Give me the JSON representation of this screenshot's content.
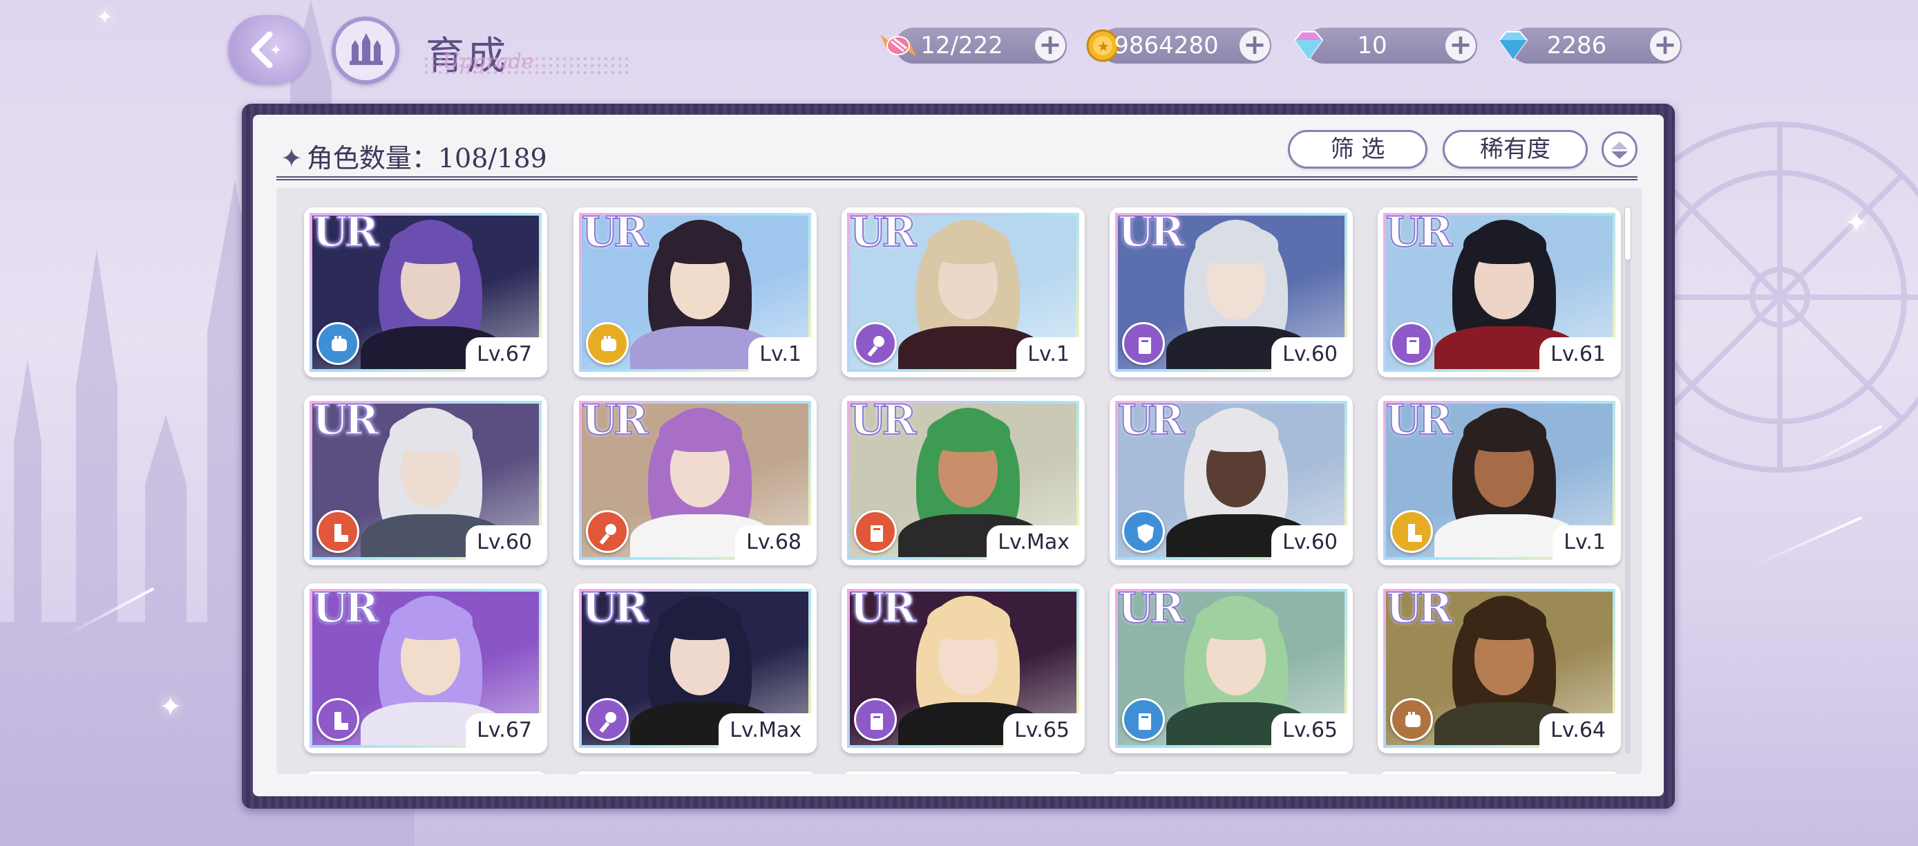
{
  "header": {
    "title": "育成",
    "subtitle_script": "Upgrade"
  },
  "resources": [
    {
      "name": "candy",
      "value": "12/222"
    },
    {
      "name": "coin",
      "value": "9864280"
    },
    {
      "name": "gem",
      "value": "10"
    },
    {
      "name": "diamond",
      "value": "2286"
    }
  ],
  "panel": {
    "count_label": "角色数量：108/189",
    "filter_label": "筛 选",
    "rarity_label": "稀有度"
  },
  "colors": {
    "vocal": "#8e5ac9",
    "blue": "#3f8fd6",
    "red": "#e0573a",
    "gold": "#e6ad22",
    "brown": "#b0733f"
  },
  "cards": [
    {
      "rarity": "UR",
      "level": "Lv.67",
      "type": "blue-fist-icon"
    },
    {
      "rarity": "UR",
      "level": "Lv.1",
      "type": "gold-fist-icon"
    },
    {
      "rarity": "UR",
      "level": "Lv.1",
      "type": "purple-mic-icon"
    },
    {
      "rarity": "UR",
      "level": "Lv.60",
      "type": "purple-book-icon"
    },
    {
      "rarity": "UR",
      "level": "Lv.61",
      "type": "purple-book-icon"
    },
    {
      "rarity": "UR",
      "level": "Lv.60",
      "type": "red-boot-icon"
    },
    {
      "rarity": "UR",
      "level": "Lv.68",
      "type": "red-mic-icon"
    },
    {
      "rarity": "UR",
      "level": "Lv.Max",
      "type": "red-book-icon"
    },
    {
      "rarity": "UR",
      "level": "Lv.60",
      "type": "blue-shield-icon"
    },
    {
      "rarity": "UR",
      "level": "Lv.1",
      "type": "gold-boot-icon"
    },
    {
      "rarity": "UR",
      "level": "Lv.67",
      "type": "purple-boot-icon"
    },
    {
      "rarity": "UR",
      "level": "Lv.Max",
      "type": "purple-mic-icon"
    },
    {
      "rarity": "UR",
      "level": "Lv.65",
      "type": "purple-book-icon"
    },
    {
      "rarity": "UR",
      "level": "Lv.65",
      "type": "blue-book-icon"
    },
    {
      "rarity": "UR",
      "level": "Lv.64",
      "type": "brown-fist-icon"
    }
  ]
}
